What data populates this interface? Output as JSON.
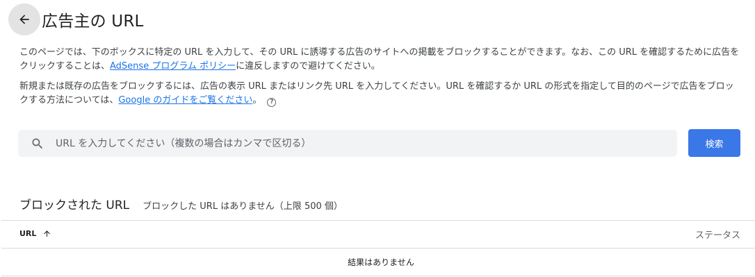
{
  "header": {
    "back_icon": "arrow-back-icon",
    "title": "広告主の URL"
  },
  "description": {
    "p1_text": "このページでは、下のボックスに特定の URL を入力して、その URL に誘導する広告のサイトへの掲載をブロックすることができます。なお、この URL を確認するために広告をクリックすることは、",
    "p1_link": "AdSense プログラム ポリシー",
    "p1_tail": "に違反しますので避けてください。",
    "p2_text": "新規または既存の広告をブロックするには、広告の表示 URL またはリンク先 URL を入力してください。URL を確認するか URL の形式を指定して目的のページで広告をブロックする方法については、",
    "p2_link": "Google のガイドをご覧ください",
    "p2_tail": "。",
    "help_icon": "help-circle-icon",
    "help_glyph": "?"
  },
  "search": {
    "icon": "search-icon",
    "placeholder": "URL を入力してください（複数の場合はカンマで区切る）",
    "value": "",
    "button_label": "検索"
  },
  "blocked": {
    "title": "ブロックされた URL",
    "subtitle": "ブロックした URL はありません（上限 500 個）"
  },
  "table": {
    "columns": [
      {
        "label": "URL",
        "sort_icon": "arrow-up-icon"
      },
      {
        "label": "ステータス"
      }
    ],
    "rows": [],
    "empty_message": "結果はありません"
  },
  "colors": {
    "accent": "#3b78e7",
    "link": "#1a73e8",
    "search_bg": "#f1f3f4"
  }
}
